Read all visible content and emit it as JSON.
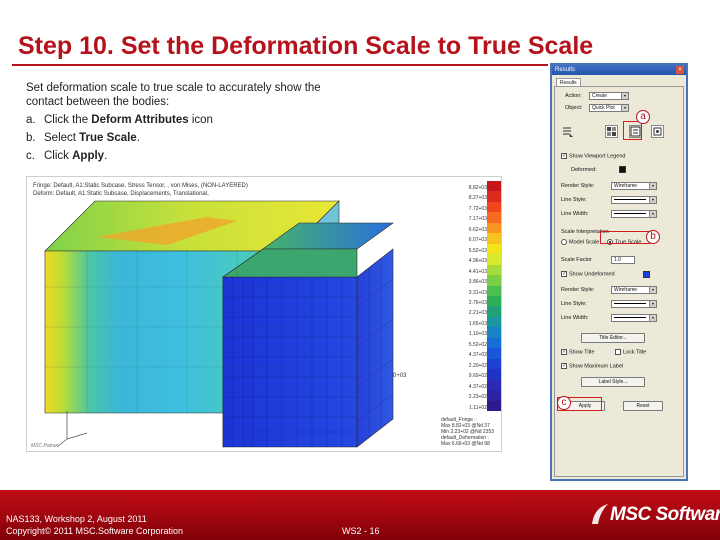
{
  "slide": {
    "title": "Step 10. Set the Deformation Scale to True Scale",
    "intro": "Set deformation scale to true scale to accurately show the contact between the bodies:",
    "steps": [
      {
        "num": "a.",
        "pre": "Click the ",
        "bold": "Deform Attributes",
        "post": " icon"
      },
      {
        "num": "b.",
        "pre": "Select ",
        "bold": "True Scale",
        "post": "."
      },
      {
        "num": "c.",
        "pre": "Click ",
        "bold": "Apply",
        "post": "."
      }
    ]
  },
  "viewport": {
    "header_line1": "Fringe: Default, A1:Static Subcase, Stress Tensor, , von Mises, (NON-LAYERED)",
    "header_line2": "Deform: Default, A1:Static Subcase, Displacements, Translational,",
    "legend_values": [
      "8.82+03",
      "8.27+03",
      "7.72+03",
      "7.17+03",
      "6.62+03",
      "6.07+03",
      "5.52+03",
      "4.96+03",
      "4.41+03",
      "3.86+03",
      "3.31+03",
      "2.76+03",
      "2.21+03",
      "1.65+03",
      "1.10+03",
      "5.52+02",
      "4.37+02",
      "2.20+02",
      "9.69+02",
      "4.37+02",
      "2.23+02",
      "1.11+02"
    ],
    "legend_colors": [
      "#c4161c",
      "#dd2b1b",
      "#f0461d",
      "#f76a1f",
      "#fa9521",
      "#f9c31f",
      "#f4e41c",
      "#d8e82a",
      "#a9dc3a",
      "#79ce46",
      "#4bbf4f",
      "#2eae57",
      "#21a17a",
      "#1a97a0",
      "#1683c4",
      "#176ed6",
      "#1a57d8",
      "#1d40d2",
      "#2232c6",
      "#2a29b8",
      "#2d22a6",
      "#2b1b8c"
    ],
    "node_label": "0+03",
    "footer_lines": [
      "default_Fringe :",
      "Max 8.82+03 @Nd 37",
      "Min 2.23+02 @Nd 2353",
      "default_Deformation :",
      "Max 6.66+03 @Nd 98"
    ],
    "logo_text": "MSC.Patran"
  },
  "panel": {
    "title": "Results",
    "tab": "Results",
    "action_label": "Action:",
    "action_value": "Create",
    "object_label": "Object:",
    "object_value": "Quick Plot",
    "show_legend": "Show Viewport Legend",
    "deformed_label": "Deformed:",
    "render_style_label": "Render Style:",
    "render_style_value": "Wireframe",
    "line_style_label": "Line Style:",
    "line_width_label": "Line Width:",
    "scale_interp_label": "Scale Interpretation",
    "model_scale": "Model Scale",
    "true_scale": "True Scale",
    "scale_factor_label": "Scale Factor",
    "scale_factor_value": "1.0",
    "show_undeformed": "Show Undeformed",
    "render_style2_value": "Wireframe",
    "title_editor_btn": "Title Editor...",
    "show_title": "Show Title",
    "lock_title": "Lock Title",
    "show_max_label": "Show Maximum Label",
    "label_style_btn": "Label Style...",
    "apply_btn": "Apply",
    "reset_btn": "Reset",
    "colors": {
      "deformed": "#111111",
      "undeformed": "#1a40e0"
    }
  },
  "callouts": {
    "a": "a",
    "b": "b",
    "c": "c"
  },
  "footer": {
    "line1": "NAS133, Workshop 2, August 2011",
    "line2": "Copyright© 2011 MSC.Software Corporation",
    "page": "WS2 - 16",
    "brand": "MSC Software"
  },
  "colors": {
    "accent": "#b5121b",
    "footer": "#a00a12"
  }
}
